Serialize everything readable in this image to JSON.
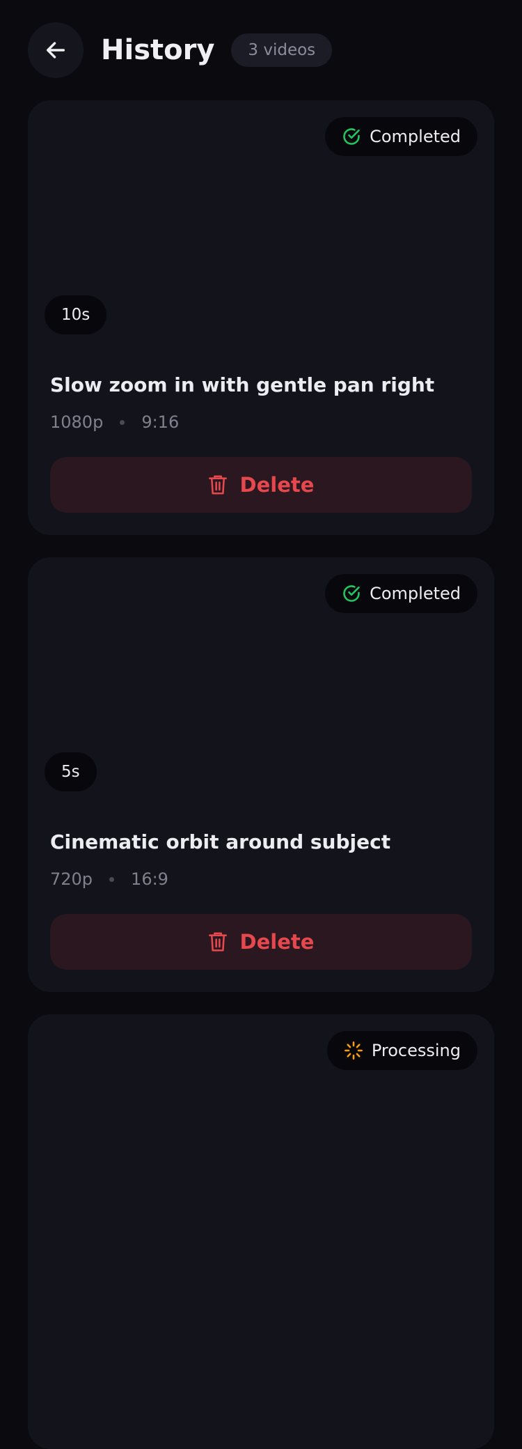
{
  "header": {
    "title": "History",
    "count": "3 videos",
    "back_icon": "arrow-left-icon"
  },
  "colors": {
    "background": "#0a0a0f",
    "card": "#13131c",
    "completed": "#22c55e",
    "processing": "#f59e0b",
    "danger": "#e5484d"
  },
  "videos": [
    {
      "status": "Completed",
      "status_icon": "check-circle-icon",
      "duration": "10s",
      "title": "Slow zoom in with gentle pan right",
      "resolution": "1080p",
      "aspect": "9:16",
      "delete_label": "Delete"
    },
    {
      "status": "Completed",
      "status_icon": "check-circle-icon",
      "duration": "5s",
      "title": "Cinematic orbit around subject",
      "resolution": "720p",
      "aspect": "16:9",
      "delete_label": "Delete"
    },
    {
      "status": "Processing",
      "status_icon": "spinner-icon"
    }
  ]
}
